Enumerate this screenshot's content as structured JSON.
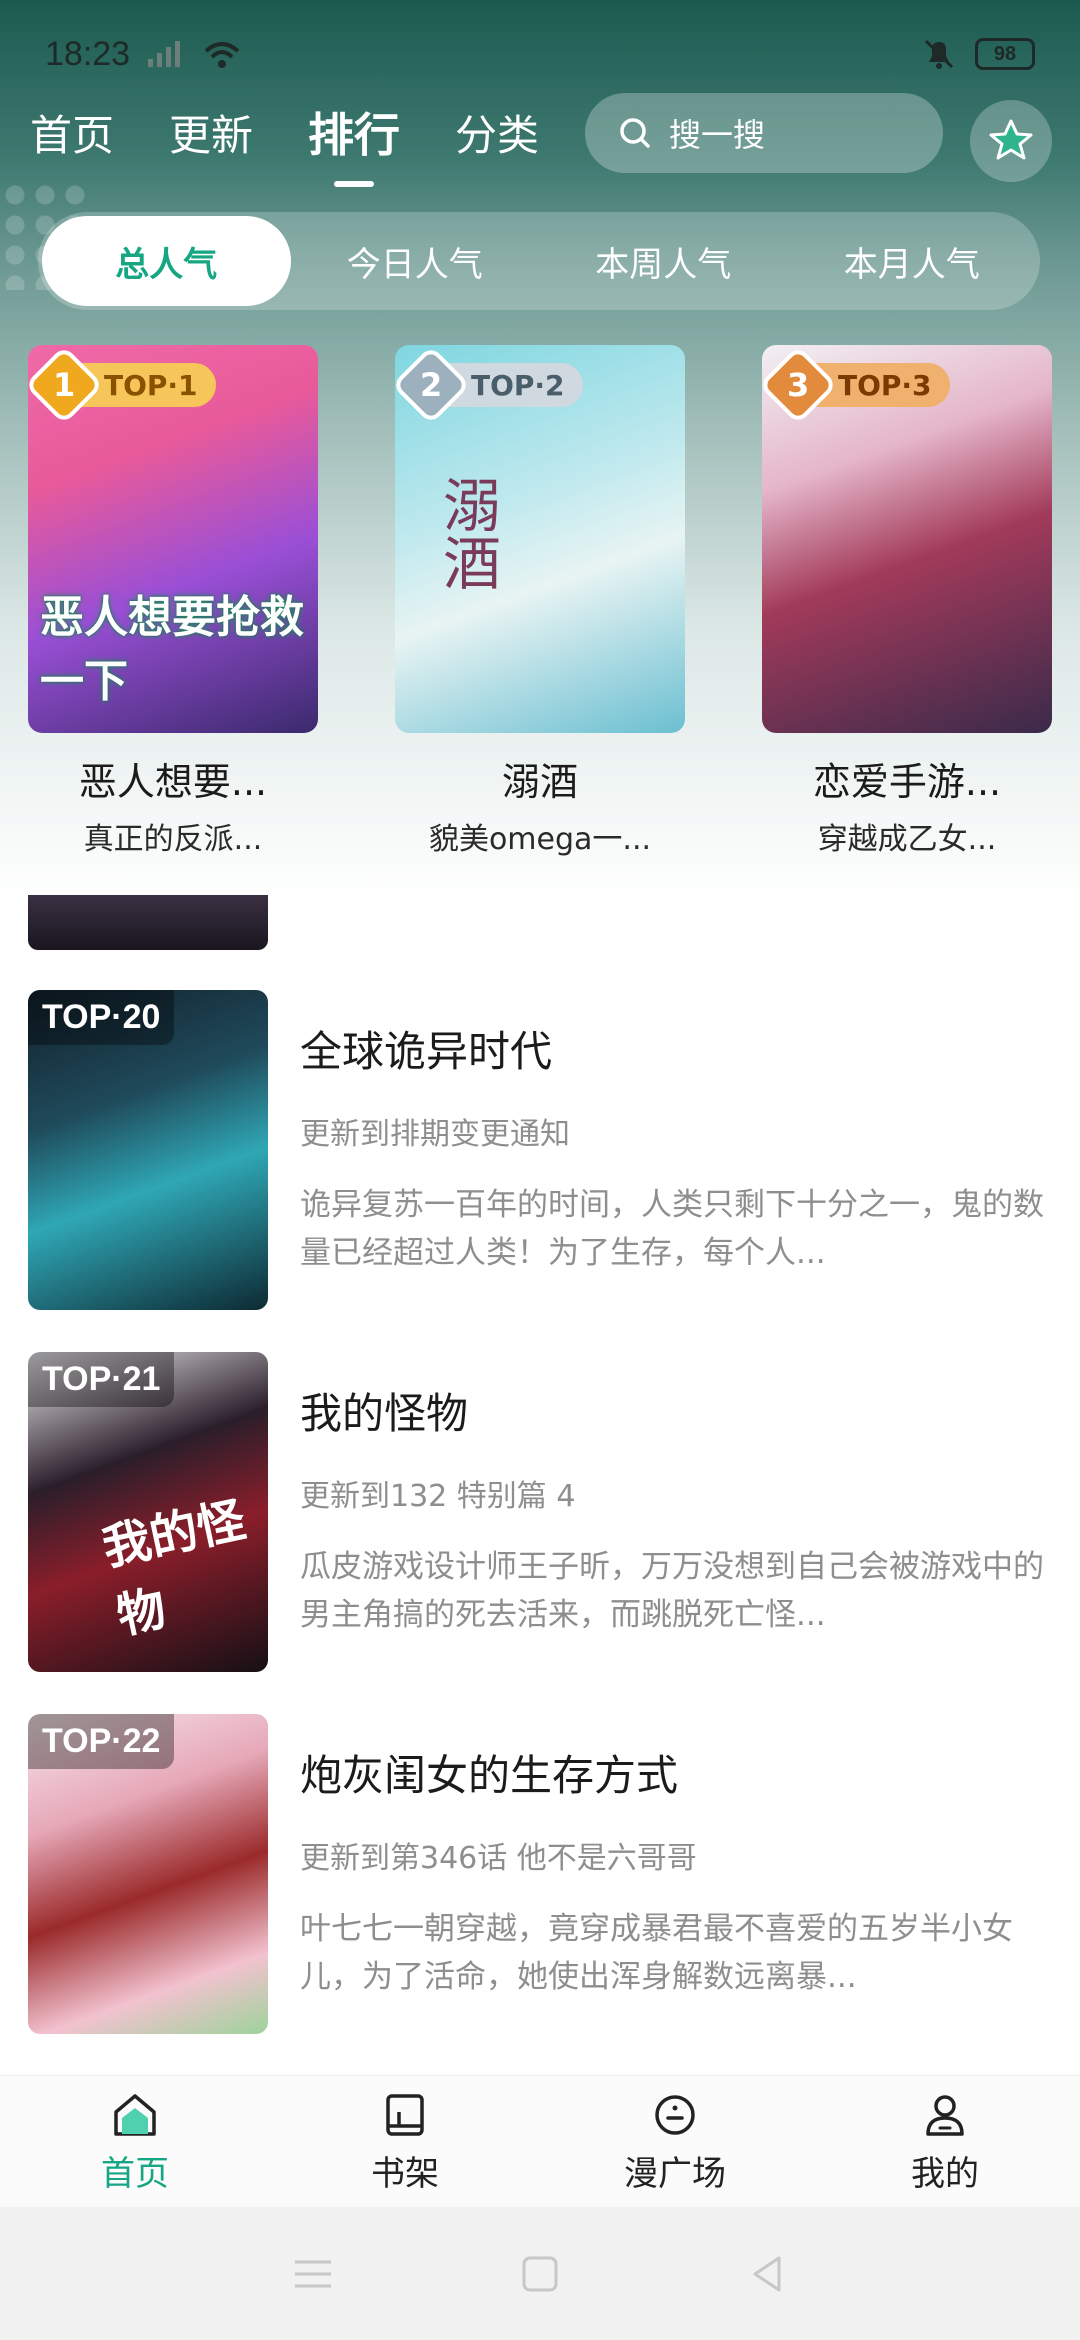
{
  "status_bar": {
    "time": "18:23",
    "battery": "98"
  },
  "top_nav": {
    "tabs": [
      {
        "label": "首页"
      },
      {
        "label": "更新"
      },
      {
        "label": "排行"
      },
      {
        "label": "分类"
      }
    ],
    "active_tab": "排行",
    "search_placeholder": "搜一搜"
  },
  "ranking_tabs": [
    {
      "label": "总人气"
    },
    {
      "label": "今日人气"
    },
    {
      "label": "本周人气"
    },
    {
      "label": "本月人气"
    }
  ],
  "top3": [
    {
      "rank": "1",
      "badge": "TOP·1",
      "title": "恶人想要...",
      "desc": "真正的反派...",
      "cover_text": "恶人想要抢救一下"
    },
    {
      "rank": "2",
      "badge": "TOP·2",
      "title": "溺酒",
      "desc": "貌美omega一...",
      "cover_text": "溺酒"
    },
    {
      "rank": "3",
      "badge": "TOP·3",
      "title": "恋爱手游...",
      "desc": "穿越成乙女..."
    }
  ],
  "list": [
    {
      "badge": "TOP·20",
      "title": "全球诡异时代",
      "update": "更新到排期变更通知",
      "summary": "诡异复苏一百年的时间，人类只剩下十分之一，鬼的数量已经超过人类！为了生存，每个人..."
    },
    {
      "badge": "TOP·21",
      "title": "我的怪物",
      "update": "更新到132 特别篇 4",
      "summary": "瓜皮游戏设计师王子昕，万万没想到自己会被游戏中的男主角搞的死去活来，而跳脱死亡怪...",
      "cover_text": "我的怪物"
    },
    {
      "badge": "TOP·22",
      "title": "炮灰闺女的生存方式",
      "update": "更新到第346话 他不是六哥哥",
      "summary": "叶七七一朝穿越，竟穿成暴君最不喜爱的五岁半小女儿，为了活命，她使出浑身解数远离暴..."
    }
  ],
  "bottom_tabs": [
    {
      "label": "首页",
      "icon": "home-icon"
    },
    {
      "label": "书架",
      "icon": "bookshelf-icon"
    },
    {
      "label": "漫广场",
      "icon": "square-icon"
    },
    {
      "label": "我的",
      "icon": "profile-icon"
    }
  ],
  "colors": {
    "accent": "#17a683"
  }
}
